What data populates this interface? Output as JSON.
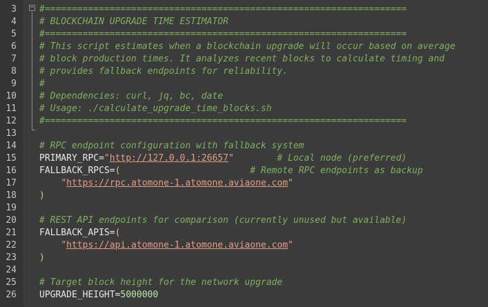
{
  "editor": {
    "lines": [
      {
        "n": "3",
        "comment": "#==================================================================="
      },
      {
        "n": "4",
        "comment": "# BLOCKCHAIN UPGRADE TIME ESTIMATOR"
      },
      {
        "n": "5",
        "comment": "#==================================================================="
      },
      {
        "n": "6",
        "comment": "# This script estimates when a blockchain upgrade will occur based on average"
      },
      {
        "n": "7",
        "comment": "# block production times. It analyzes recent blocks to calculate timing and"
      },
      {
        "n": "8",
        "comment": "# provides fallback endpoints for reliability."
      },
      {
        "n": "9",
        "comment": "#"
      },
      {
        "n": "10",
        "comment": "# Dependencies: curl, jq, bc, date"
      },
      {
        "n": "11",
        "comment": "# Usage: ./calculate_upgrade_time_blocks.sh"
      },
      {
        "n": "12",
        "comment": "#==================================================================="
      },
      {
        "n": "13"
      },
      {
        "n": "14",
        "comment": "# RPC endpoint configuration with fallback system"
      },
      {
        "n": "15",
        "ident": "PRIMARY_RPC",
        "op": "=",
        "q1": "\"",
        "url": "http://127.0.0.1:26657",
        "q2": "\"",
        "pad": "        ",
        "comment": "# Local node (preferred)"
      },
      {
        "n": "16",
        "ident": "FALLBACK_RPCS",
        "op": "=",
        "paren": "(",
        "pad": "                        ",
        "comment": "# Remote RPC endpoints as backup"
      },
      {
        "n": "17",
        "indent": "    ",
        "q1": "\"",
        "url": "https://rpc.atomone-1.atomone.aviaone.com",
        "q2": "\""
      },
      {
        "n": "18",
        "paren": ")"
      },
      {
        "n": "19"
      },
      {
        "n": "20",
        "comment": "# REST API endpoints for comparison (currently unused but available)"
      },
      {
        "n": "21",
        "ident": "FALLBACK_APIS",
        "op": "=",
        "paren": "("
      },
      {
        "n": "22",
        "indent": "    ",
        "q1": "\"",
        "url": "https://api.atomone-1.atomone.aviaone.com",
        "q2": "\""
      },
      {
        "n": "23",
        "paren": ")"
      },
      {
        "n": "24"
      },
      {
        "n": "25",
        "comment": "# Target block height for the network upgrade"
      },
      {
        "n": "26",
        "ident": "UPGRADE_HEIGHT",
        "op": "=",
        "num": "5000000"
      }
    ],
    "fold_marker": "−"
  }
}
